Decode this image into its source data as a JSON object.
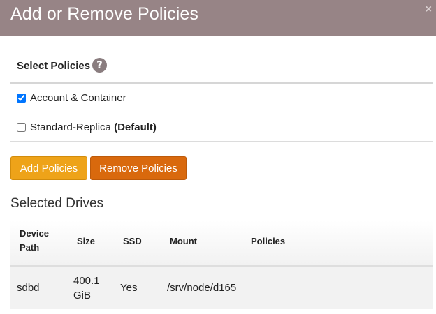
{
  "dialog": {
    "title": "Add or Remove Policies",
    "close_label": "×"
  },
  "select_policies": {
    "heading": "Select Policies",
    "help_icon": "?",
    "policies": [
      {
        "label": "Account & Container",
        "checked": true,
        "suffix": ""
      },
      {
        "label": "Standard-Replica",
        "checked": false,
        "suffix": "(Default)"
      }
    ]
  },
  "buttons": {
    "add_label": "Add Policies",
    "remove_label": "Remove Policies"
  },
  "selected_drives": {
    "heading": "Selected Drives",
    "columns": {
      "device_path_1": "Device",
      "device_path_2": "Path",
      "size": "Size",
      "ssd": "SSD",
      "mount": "Mount",
      "policies": "Policies"
    },
    "rows": [
      {
        "device_path": "sdbd",
        "size_1": "400.1",
        "size_2": "GiB",
        "ssd": "Yes",
        "mount": "/srv/node/d165",
        "policies": ""
      }
    ]
  },
  "colors": {
    "header_bg": "#978486",
    "add_button": "#eea319",
    "remove_button": "#d9690d"
  }
}
